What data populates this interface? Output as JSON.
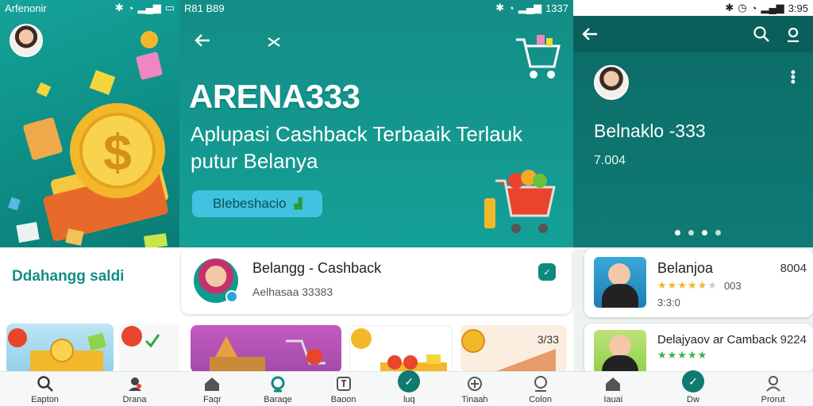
{
  "colors": {
    "primary": "#0e6f6a",
    "accent": "#14a097",
    "gold": "#f3b82a",
    "star": "#f1b52c"
  },
  "panel1": {
    "status_left": "Arfenonir",
    "section_title": "Ddahangg saldi",
    "nav": [
      {
        "label": "Eapton",
        "icon": "search-icon"
      },
      {
        "label": "Drana",
        "icon": "profile-icon"
      }
    ]
  },
  "panel2": {
    "status_left": "R81 B89",
    "status_right": "1337",
    "brand": "ARENA333",
    "tagline_line1": "Aplupasi Cashback Terbaaik Terlauk",
    "tagline_line2": "putur Belanya",
    "cta_label": "Blebeshacio",
    "card_title": "Belangg - Cashback",
    "card_subtitle": "Aelhasaa 33383",
    "price_tile": "3/33",
    "nav": [
      {
        "label": "Faqr",
        "icon": "home-icon"
      },
      {
        "label": "Baraqe",
        "icon": "scan-icon"
      },
      {
        "label": "Baoon",
        "icon": "wallet-icon"
      },
      {
        "label": "luq",
        "icon": "check-icon"
      },
      {
        "label": "Tinaah",
        "icon": "plus-icon"
      },
      {
        "label": "Colon",
        "icon": "profile-icon"
      }
    ]
  },
  "panel3": {
    "status_right": "3:95",
    "profile_title": "Belnaklo -333",
    "profile_subtitle": "7.004",
    "list": [
      {
        "title": "Belanjoa",
        "amount": "8004",
        "rating_text": "003",
        "sub": "3:3:0"
      },
      {
        "title": "Delajyaov ar Camback",
        "amount": "9224"
      }
    ],
    "nav": [
      {
        "label": "Iauai",
        "icon": "home-icon"
      },
      {
        "label": "Dw",
        "icon": "check-icon"
      },
      {
        "label": "Prorut",
        "icon": "profile-icon"
      }
    ]
  }
}
